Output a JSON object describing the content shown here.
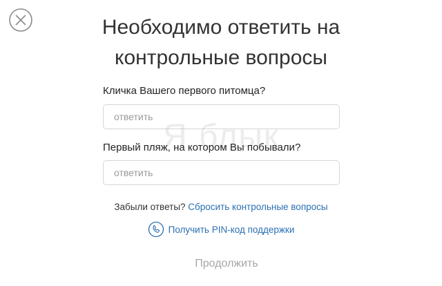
{
  "dialog": {
    "title_line1": "Необходимо ответить на",
    "title_line2": "контрольные вопросы",
    "close_icon": "close-circle-icon"
  },
  "questions": [
    {
      "label": "Кличка Вашего первого питомца?",
      "answer_value": "",
      "placeholder": "ответить"
    },
    {
      "label": "Первый пляж, на котором Вы побывали?",
      "answer_value": "",
      "placeholder": "ответить"
    }
  ],
  "forgot": {
    "text": "Забыли ответы? ",
    "reset_link": "Сбросить контрольные вопросы"
  },
  "support": {
    "icon": "phone-icon",
    "pin_link": "Получить PIN-код поддержки"
  },
  "actions": {
    "continue_label": "Продолжить"
  },
  "watermark": {
    "text": "Я блык"
  },
  "colors": {
    "link": "#2a6fb3",
    "disabled_text": "#a6a6a6",
    "input_border": "#d6d6d6"
  }
}
